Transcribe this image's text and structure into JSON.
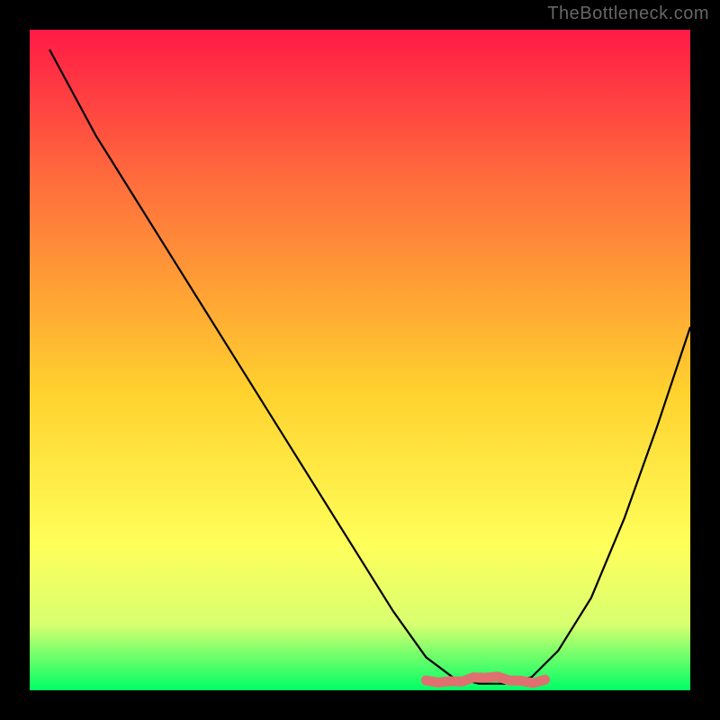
{
  "credit": "TheBottleneck.com",
  "colors": {
    "frame": "#000000",
    "curve": "#000000",
    "bump": "#e07070",
    "grad_top": "#ff1a46",
    "grad_mid1": "#ff6a3d",
    "grad_mid2": "#ffd22e",
    "grad_mid3": "#ffff5a",
    "grad_mid4": "#d8ff70",
    "grad_bot": "#00ff66"
  },
  "chart_data": {
    "type": "line",
    "title": "",
    "xlabel": "",
    "ylabel": "",
    "xlim": [
      0,
      100
    ],
    "ylim": [
      0,
      100
    ],
    "legend": null,
    "series": [
      {
        "name": "bottleneck-curve",
        "x": [
          3,
          10,
          20,
          30,
          40,
          50,
          55,
          60,
          64,
          68,
          72,
          76,
          80,
          85,
          90,
          95,
          100
        ],
        "y": [
          97,
          84,
          68,
          52,
          36,
          20,
          12,
          5,
          2,
          1,
          1,
          2,
          6,
          14,
          26,
          40,
          55
        ]
      }
    ],
    "annotations": [
      {
        "name": "flat-bump",
        "x_range": [
          60,
          78
        ],
        "y": 1.5
      }
    ]
  }
}
